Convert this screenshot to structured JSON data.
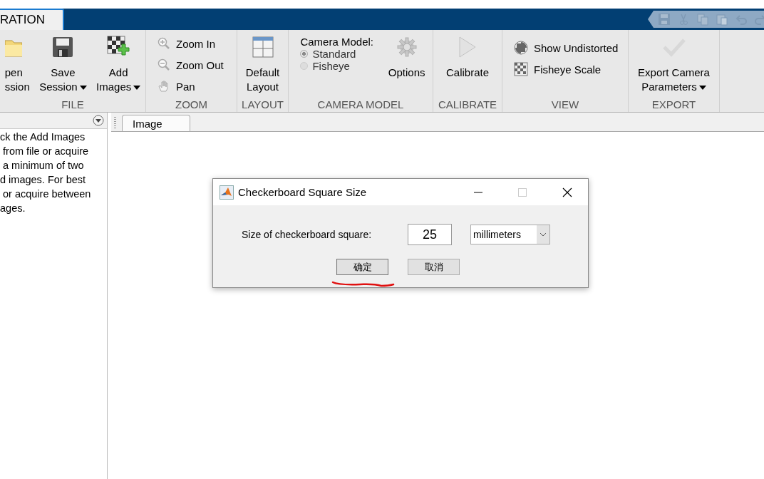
{
  "app_tab": {
    "label": "RATION",
    "selected": true
  },
  "ribbon": {
    "sections": [
      {
        "title": "FILE",
        "buttons": [
          {
            "label": "pen\nssion"
          },
          {
            "label": "Save\nSession",
            "menu": true
          },
          {
            "label": "Add\nImages",
            "menu": true
          }
        ]
      },
      {
        "title": "ZOOM",
        "buttons": [
          {
            "label": "Zoom In"
          },
          {
            "label": "Zoom Out"
          },
          {
            "label": "Pan"
          }
        ]
      },
      {
        "title": "LAYOUT",
        "buttons": [
          {
            "label": "Default\nLayout"
          }
        ]
      },
      {
        "title": "CAMERA MODEL",
        "heading": "Camera Model:",
        "radios": [
          {
            "label": "Standard",
            "selected": true
          },
          {
            "label": "Fisheye",
            "selected": false
          }
        ],
        "buttons": [
          {
            "label": "Options"
          }
        ]
      },
      {
        "title": "CALIBRATE",
        "buttons": [
          {
            "label": "Calibrate"
          }
        ]
      },
      {
        "title": "VIEW",
        "buttons": [
          {
            "label": "Show Undistorted"
          },
          {
            "label": "Fisheye Scale"
          }
        ]
      },
      {
        "title": "EXPORT",
        "buttons": [
          {
            "label": "Export Camera\nParameters",
            "menu": true
          }
        ]
      }
    ]
  },
  "left_panel": {
    "text": "ck the Add Images\n from file or acquire\n a minimum of two\nd images. For best\n or acquire between\nages."
  },
  "doc_tabs": [
    {
      "label": "Image",
      "selected": true
    }
  ],
  "dialog": {
    "title": "Checkerboard Square Size",
    "label": "Size of checkerboard square:",
    "value": "25",
    "unit": "millimeters",
    "buttons": [
      {
        "label": "确定",
        "focused": true
      },
      {
        "label": "取消",
        "focused": false
      }
    ]
  }
}
